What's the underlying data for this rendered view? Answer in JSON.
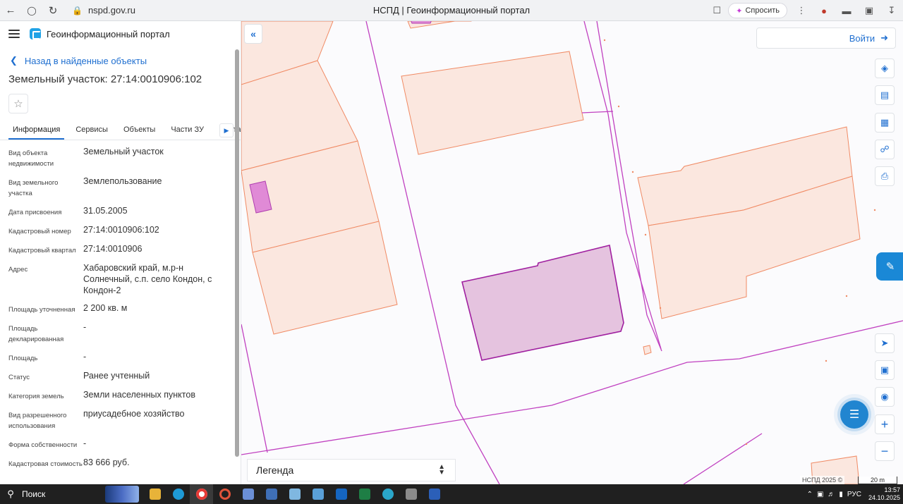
{
  "browser": {
    "url": "nspd.gov.ru",
    "tab_title": "НСПД | Геоинформационный портал",
    "ask_label": "Спросить"
  },
  "app": {
    "title": "Геоинформационный портал"
  },
  "panel": {
    "back_label": "Назад в найденные объекты",
    "object_title": "Земельный участок: 27:14:0010906:102",
    "tabs": [
      {
        "label": "Информация",
        "active": true
      },
      {
        "label": "Сервисы",
        "active": false
      },
      {
        "label": "Объекты",
        "active": false
      },
      {
        "label": "Части ЗУ",
        "active": false
      },
      {
        "label": "Соста",
        "active": false
      }
    ],
    "props": [
      {
        "label": "Вид объекта недвижимости",
        "value": "Земельный участок"
      },
      {
        "label": "Вид земельного участка",
        "value": "Землепользование"
      },
      {
        "label": "Дата присвоения",
        "value": "31.05.2005"
      },
      {
        "label": "Кадастровый номер",
        "value": "27:14:0010906:102"
      },
      {
        "label": "Кадастровый квартал",
        "value": "27:14:0010906"
      },
      {
        "label": "Адрес",
        "value": "Хабаровский край, м.р-н Солнечный, с.п. село Кондон, с Кондон-2"
      },
      {
        "label": "Площадь уточненная",
        "value": "2 200 кв. м"
      },
      {
        "label": "Площадь декларированная",
        "value": "-"
      },
      {
        "label": "Площадь",
        "value": "-"
      },
      {
        "label": "Статус",
        "value": "Ранее учтенный"
      },
      {
        "label": "Категория земель",
        "value": "Земли населенных пунктов"
      },
      {
        "label": "Вид разрешенного использования",
        "value": "приусадебное хозяйство"
      },
      {
        "label": "Форма собственности",
        "value": "-"
      },
      {
        "label": "Кадастровая стоимость",
        "value": "83 666 руб."
      }
    ]
  },
  "map": {
    "login_label": "Войти",
    "legend_label": "Легенда",
    "attribution": "НСПД 2025 ©",
    "scale_label": "20 m",
    "colors": {
      "parcel_fill": "#fbe7df",
      "parcel_stroke": "#f08a64",
      "selected_fill": "#e5c3df",
      "selected_stroke": "#a020a0",
      "road_line": "#c040c0"
    }
  },
  "taskbar": {
    "search_label": "Поиск",
    "lang": "РУС",
    "time": "13:57",
    "date": "24.10.2025"
  }
}
